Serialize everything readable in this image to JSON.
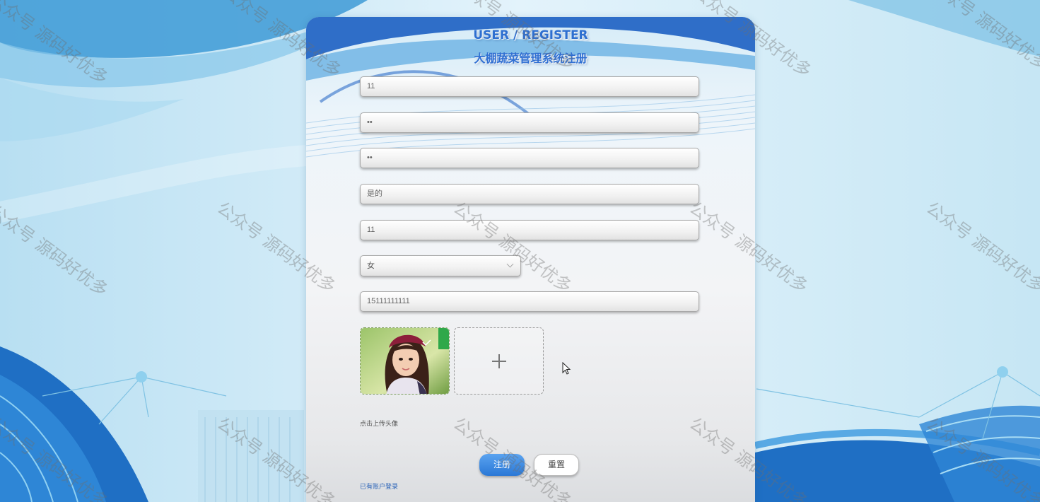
{
  "header": {
    "title_en": "USER / REGISTER",
    "title_cn": "大棚蔬菜管理系统注册"
  },
  "form": {
    "account": "11",
    "password": "••",
    "confirm_password": "••",
    "name": "是的",
    "age": "11",
    "gender": "女",
    "phone": "15111111111",
    "upload_tip": "点击上传头像"
  },
  "buttons": {
    "register": "注册",
    "reset": "重置"
  },
  "links": {
    "login": "已有账户登录"
  },
  "watermark": "公众号 源码好优多",
  "colors": {
    "primary": "#2a78d6",
    "background": "#cfeaf6"
  }
}
